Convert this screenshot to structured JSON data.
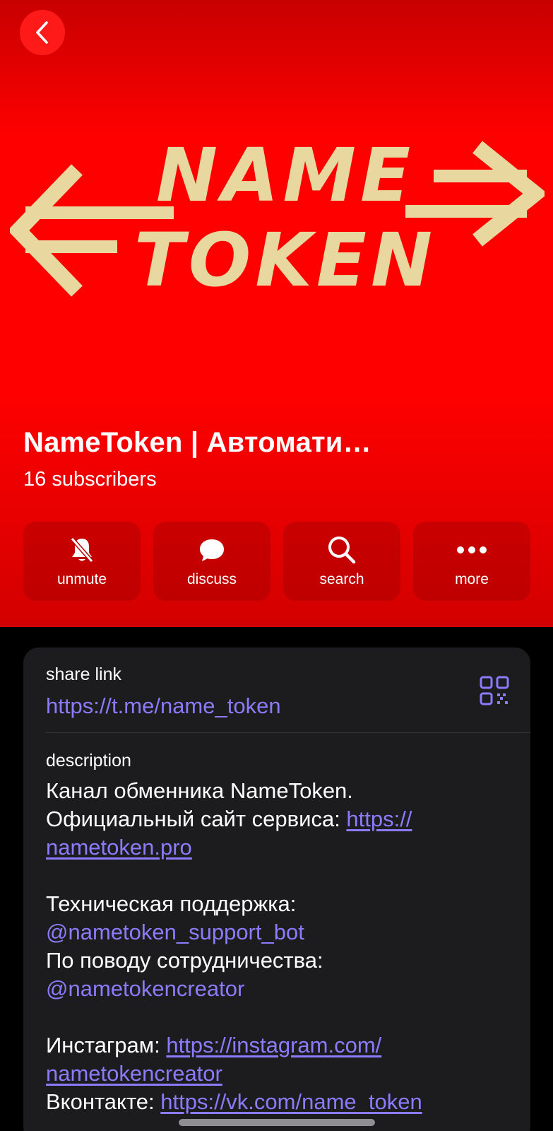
{
  "header": {
    "logo_text_line1": "NAME",
    "logo_text_line2": "TOKEN",
    "title": "NameToken | Автомати…",
    "subscribers": "16 subscribers",
    "bg_color": "#ff0000",
    "logo_color": "#e8d8a0"
  },
  "actions": [
    {
      "label": "unmute",
      "icon": "bell-slash-icon"
    },
    {
      "label": "discuss",
      "icon": "chat-bubble-icon"
    },
    {
      "label": "search",
      "icon": "search-icon"
    },
    {
      "label": "more",
      "icon": "ellipsis-icon"
    }
  ],
  "info": {
    "share_label": "share link",
    "share_url": "https://t.me/name_token",
    "description_label": "description",
    "description": {
      "line1": "Канал обменника NameToken.",
      "line2_text": "Официальный сайт сервиса: ",
      "line2_link_a": "https://",
      "line3_link_b": "nametoken.pro",
      "support_text": "Техническая поддержка:",
      "support_mention": "@nametoken_support_bot",
      "coop_text": "По поводу сотрудничества:",
      "coop_mention": "@nametokencreator",
      "insta_text": "Инстаграм: ",
      "insta_link_a": "https://instagram.com/",
      "insta_link_b": "nametokencreator",
      "vk_text": "Вконтакте: ",
      "vk_link": "https://vk.com/name_token"
    }
  },
  "colors": {
    "accent_link": "#8b7bff",
    "card_bg": "#1c1c1e"
  }
}
